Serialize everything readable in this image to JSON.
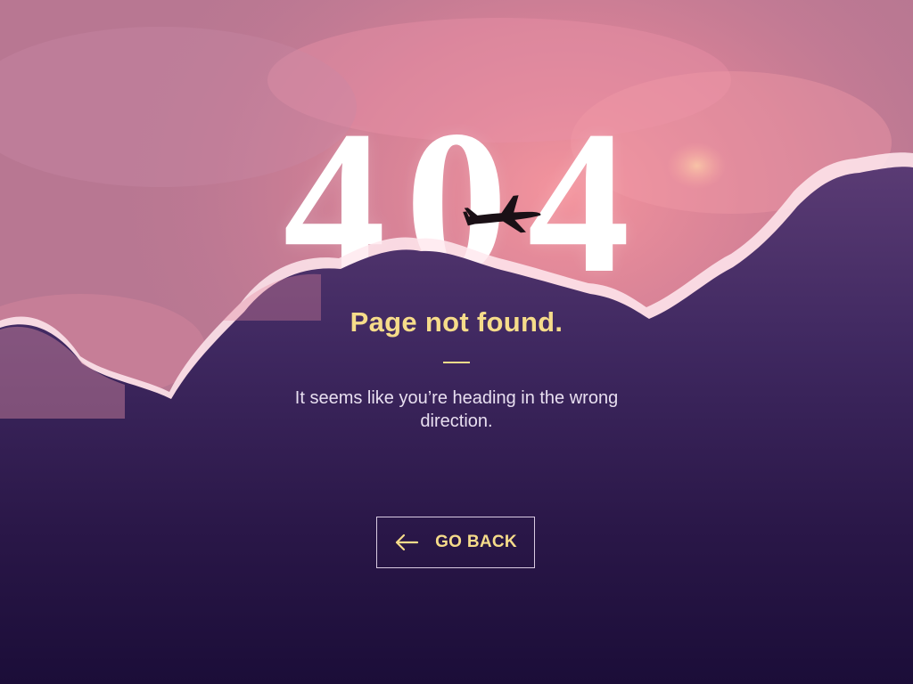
{
  "error": {
    "code": "404",
    "title": "Page not found.",
    "message": "It seems like you’re heading in the wrong direction."
  },
  "action": {
    "go_back_label": "GO BACK",
    "icon": "arrow-left-icon"
  },
  "background": {
    "subject": "sunset clouds",
    "icon": "airplane-icon"
  },
  "colors": {
    "accent": "#f6dc8a",
    "text": "#e8dff0",
    "sky_top": "#c07b95",
    "cloud_dark": "#2a1748",
    "number": "#ffffff"
  }
}
